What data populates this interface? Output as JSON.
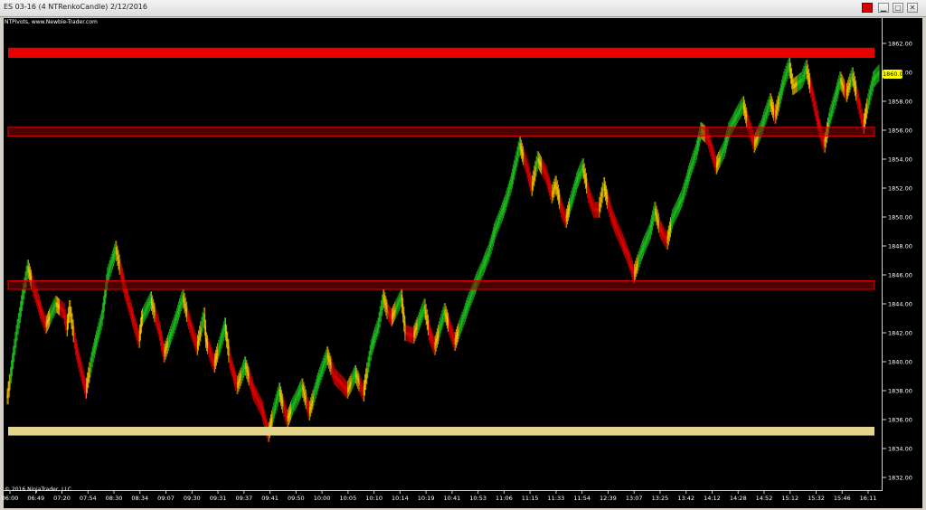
{
  "window": {
    "title": "ES 03-16 (4 NTRenkoCandle)  2/12/2016",
    "buttons": {
      "minimize": "▁",
      "restore": "▢",
      "close": "✕"
    }
  },
  "chart": {
    "indicator_label": "NTPivots, www.Newbie-Trader.com",
    "copyright": "© 2016 NinjaTrader, LLC",
    "current_price_label": "1860.00",
    "colors": {
      "up": "#1dbf1d",
      "down": "#e10000",
      "neutral": "#f2c200",
      "zone_red": "#e60000",
      "zone_dark": "#8a0000",
      "zone_tan": "#e6d68c"
    }
  },
  "chart_data": {
    "type": "renko",
    "instrument": "ES 03-16",
    "date": "2/12/2016",
    "brick_size": 4,
    "ylim": [
      1831,
      1863
    ],
    "yticks": [
      "1862.00",
      "1860.00",
      "1858.00",
      "1856.00",
      "1854.00",
      "1852.00",
      "1850.00",
      "1848.00",
      "1846.00",
      "1844.00",
      "1842.00",
      "1840.00",
      "1838.00",
      "1836.00",
      "1834.00",
      "1832.00"
    ],
    "xticks": [
      "06:00",
      "06:49",
      "07:20",
      "07:54",
      "08:30",
      "08:34",
      "09:07",
      "09:30",
      "09:31",
      "09:37",
      "09:41",
      "09:50",
      "10:00",
      "10:05",
      "10:10",
      "10:14",
      "10:19",
      "10:41",
      "10:53",
      "11:06",
      "11:15",
      "11:33",
      "11:54",
      "12:39",
      "13:07",
      "13:25",
      "13:42",
      "14:12",
      "14:28",
      "14:52",
      "15:12",
      "15:32",
      "15:46",
      "16:11"
    ],
    "zones": [
      {
        "from": 1861.0,
        "to": 1861.7,
        "style": "solid-red"
      },
      {
        "from": 1855.6,
        "to": 1856.2,
        "style": "outline-red"
      },
      {
        "from": 1845.0,
        "to": 1845.6,
        "style": "outline-red"
      },
      {
        "from": 1834.9,
        "to": 1835.5,
        "style": "solid-tan"
      }
    ],
    "price_path": [
      [
        0,
        1837.6
      ],
      [
        9,
        1842
      ],
      [
        20,
        1846.5
      ],
      [
        33,
        1843.5
      ],
      [
        38,
        1842.5
      ],
      [
        48,
        1844
      ],
      [
        56,
        1843.5
      ],
      [
        59,
        1842.3
      ],
      [
        62,
        1843.7
      ],
      [
        68,
        1841
      ],
      [
        78,
        1838
      ],
      [
        85,
        1840.5
      ],
      [
        94,
        1843
      ],
      [
        100,
        1846
      ],
      [
        108,
        1847.8
      ],
      [
        117,
        1845
      ],
      [
        127,
        1842.5
      ],
      [
        131,
        1841.5
      ],
      [
        134,
        1843
      ],
      [
        143,
        1844.3
      ],
      [
        152,
        1842
      ],
      [
        156,
        1840.5
      ],
      [
        166,
        1842.5
      ],
      [
        175,
        1844.5
      ],
      [
        180,
        1843
      ],
      [
        189,
        1841
      ],
      [
        196,
        1843.2
      ],
      [
        198,
        1841.5
      ],
      [
        206,
        1839.8
      ],
      [
        212,
        1841.2
      ],
      [
        217,
        1842.5
      ],
      [
        222,
        1840
      ],
      [
        229,
        1838.3
      ],
      [
        237,
        1839.8
      ],
      [
        245,
        1838
      ],
      [
        254,
        1836.7
      ],
      [
        260,
        1835
      ],
      [
        271,
        1838
      ],
      [
        279,
        1836
      ],
      [
        285,
        1837
      ],
      [
        294,
        1838.3
      ],
      [
        301,
        1836.5
      ],
      [
        309,
        1838.5
      ],
      [
        319,
        1840.5
      ],
      [
        326,
        1839
      ],
      [
        333,
        1838.5
      ],
      [
        339,
        1838
      ],
      [
        347,
        1839.2
      ],
      [
        355,
        1837.8
      ],
      [
        363,
        1841
      ],
      [
        370,
        1842.5
      ],
      [
        375,
        1844.5
      ],
      [
        379,
        1843.5
      ],
      [
        383,
        1843
      ],
      [
        393,
        1844.5
      ],
      [
        397,
        1842
      ],
      [
        405,
        1841.8
      ],
      [
        416,
        1843.8
      ],
      [
        421,
        1842
      ],
      [
        426,
        1841
      ],
      [
        436,
        1843.5
      ],
      [
        446,
        1841.3
      ],
      [
        457,
        1843.5
      ],
      [
        466,
        1845.2
      ],
      [
        480,
        1847.5
      ],
      [
        486,
        1849
      ],
      [
        497,
        1851
      ],
      [
        503,
        1852.5
      ],
      [
        508,
        1854
      ],
      [
        511,
        1855
      ],
      [
        518,
        1853.5
      ],
      [
        523,
        1852
      ],
      [
        529,
        1854
      ],
      [
        537,
        1853
      ],
      [
        543,
        1851.5
      ],
      [
        547,
        1852.3
      ],
      [
        553,
        1850.5
      ],
      [
        557,
        1849.8
      ],
      [
        562,
        1851
      ],
      [
        568,
        1852.5
      ],
      [
        574,
        1853.5
      ],
      [
        580,
        1851.5
      ],
      [
        585,
        1850.5
      ],
      [
        590,
        1850.5
      ],
      [
        595,
        1852.2
      ],
      [
        603,
        1850
      ],
      [
        612,
        1848.5
      ],
      [
        618,
        1847.5
      ],
      [
        625,
        1846
      ],
      [
        632,
        1847.5
      ],
      [
        641,
        1849
      ],
      [
        646,
        1850.5
      ],
      [
        651,
        1849.2
      ],
      [
        658,
        1848.3
      ],
      [
        664,
        1850
      ],
      [
        673,
        1851.3
      ],
      [
        680,
        1853
      ],
      [
        687,
        1854.5
      ],
      [
        692,
        1856
      ],
      [
        699,
        1855.5
      ],
      [
        707,
        1853.5
      ],
      [
        715,
        1854.7
      ],
      [
        720,
        1856
      ],
      [
        726,
        1856.8
      ],
      [
        734,
        1857.8
      ],
      [
        739,
        1856.5
      ],
      [
        745,
        1855
      ],
      [
        753,
        1856.3
      ],
      [
        761,
        1858
      ],
      [
        766,
        1857
      ],
      [
        775,
        1859.5
      ],
      [
        780,
        1860.5
      ],
      [
        784,
        1859
      ],
      [
        793,
        1859.5
      ],
      [
        797,
        1860.3
      ],
      [
        803,
        1858.5
      ],
      [
        809,
        1856.5
      ],
      [
        815,
        1855
      ],
      [
        821,
        1857
      ],
      [
        831,
        1859.5
      ],
      [
        837,
        1858.5
      ],
      [
        843,
        1859.8
      ],
      [
        849,
        1858
      ],
      [
        854,
        1856.3
      ],
      [
        859,
        1858
      ],
      [
        864,
        1859.5
      ],
      [
        870,
        1860
      ]
    ]
  }
}
